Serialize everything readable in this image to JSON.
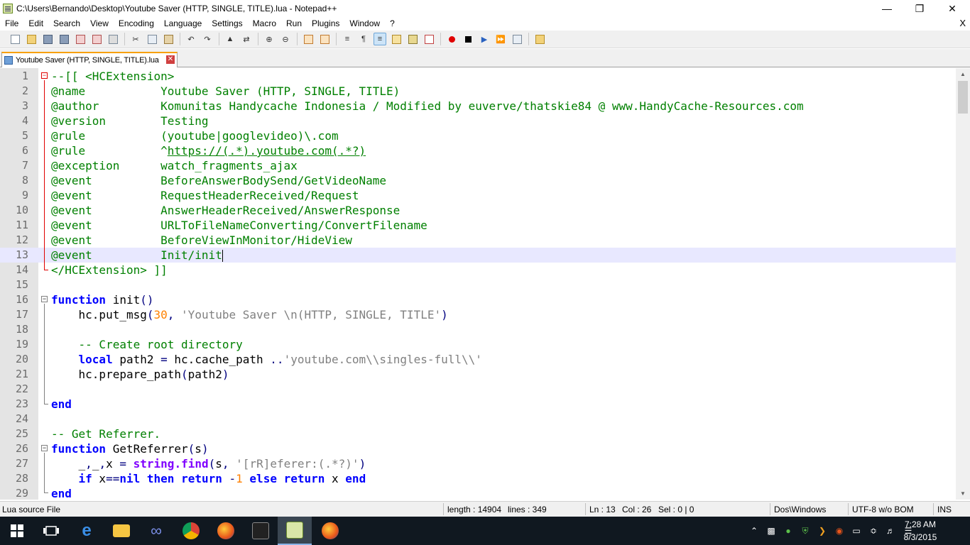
{
  "window": {
    "title": "C:\\Users\\Bernando\\Desktop\\Youtube Saver (HTTP, SINGLE, TITLE).lua - Notepad++",
    "minimize_icon": "minimize-icon",
    "maximize_icon": "restore-icon",
    "close_icon": "close-icon"
  },
  "menu": {
    "items": [
      "File",
      "Edit",
      "Search",
      "View",
      "Encoding",
      "Language",
      "Settings",
      "Macro",
      "Run",
      "Plugins",
      "Window",
      "?"
    ],
    "close_label": "X"
  },
  "toolbar": {
    "buttons": [
      "new-file-icon",
      "open-file-icon",
      "save-icon",
      "save-all-icon",
      "close-file-icon",
      "close-all-icon",
      "print-icon",
      "cut-icon",
      "copy-icon",
      "paste-icon",
      "undo-icon",
      "redo-icon",
      "find-icon",
      "replace-icon",
      "zoom-in-icon",
      "zoom-out-icon",
      "sync-vertical-icon",
      "sync-horizontal-icon",
      "word-wrap-icon",
      "show-all-chars-icon",
      "indent-guide-icon",
      "user-language-icon",
      "doc-map-icon",
      "function-list-icon",
      "record-macro-icon",
      "stop-record-icon",
      "playback-macro-icon",
      "run-macro-multiple-icon",
      "save-macro-icon",
      "plugin-icon"
    ]
  },
  "tab": {
    "label": "Youtube Saver (HTTP, SINGLE, TITLE).lua",
    "close_icon": "tab-close-icon"
  },
  "editor": {
    "current_line": 13,
    "lines": [
      {
        "n": "1",
        "t": "--[[ <HCExtension>"
      },
      {
        "n": "2",
        "t": "@name           Youtube Saver (HTTP, SINGLE, TITLE)"
      },
      {
        "n": "3",
        "t": "@author         Komunitas Handycache Indonesia / Modified by euverve/thatskie84 @ www.HandyCache-Resources.com"
      },
      {
        "n": "4",
        "t": "@version        Testing"
      },
      {
        "n": "5",
        "t": "@rule           (youtube|googlevideo)\\.com"
      },
      {
        "n": "6",
        "t": "@rule           ^https://(.*).youtube.com(.*?)"
      },
      {
        "n": "7",
        "t": "@exception      watch_fragments_ajax"
      },
      {
        "n": "8",
        "t": "@event          BeforeAnswerBodySend/GetVideoName"
      },
      {
        "n": "9",
        "t": "@event          RequestHeaderReceived/Request"
      },
      {
        "n": "10",
        "t": "@event          AnswerHeaderReceived/AnswerResponse"
      },
      {
        "n": "11",
        "t": "@event          URLToFileNameConverting/ConvertFilename"
      },
      {
        "n": "12",
        "t": "@event          BeforeViewInMonitor/HideView"
      },
      {
        "n": "13",
        "t": "@event          Init/init"
      },
      {
        "n": "14",
        "t": "</HCExtension> ]]"
      },
      {
        "n": "15",
        "t": ""
      },
      {
        "n": "16",
        "t": "function init()"
      },
      {
        "n": "17",
        "t": "    hc.put_msg(30, 'Youtube Saver \\n(HTTP, SINGLE, TITLE')"
      },
      {
        "n": "18",
        "t": ""
      },
      {
        "n": "19",
        "t": "    -- Create root directory"
      },
      {
        "n": "20",
        "t": "    local path2 = hc.cache_path ..'youtube.com\\\\singles-full\\\\'"
      },
      {
        "n": "21",
        "t": "    hc.prepare_path(path2)"
      },
      {
        "n": "22",
        "t": ""
      },
      {
        "n": "23",
        "t": "end"
      },
      {
        "n": "24",
        "t": ""
      },
      {
        "n": "25",
        "t": "-- Get Referrer."
      },
      {
        "n": "26",
        "t": "function GetReferrer(s)"
      },
      {
        "n": "27",
        "t": "    _,_,x = string.find(s, '[rR]eferer:(.*?)')"
      },
      {
        "n": "28",
        "t": "    if x==nil then return -1 else return x end"
      },
      {
        "n": "29",
        "t": "end"
      }
    ]
  },
  "status": {
    "file_type": "Lua source File",
    "length": "length : 14904",
    "lines": "lines : 349",
    "ln": "Ln : 13",
    "col": "Col : 26",
    "sel": "Sel : 0 | 0",
    "eol": "Dos\\Windows",
    "encoding": "UTF-8 w/o BOM",
    "mode": "INS"
  },
  "taskbar": {
    "apps": [
      "windows-start-icon",
      "task-view-icon",
      "edge-icon",
      "file-explorer-icon",
      "infinity-app-icon",
      "chrome-icon",
      "firefox-icon",
      "instant-demo-icon",
      "notepadpp-icon",
      "firefox-alt-icon"
    ],
    "tray_icons": [
      "chevron-up-icon",
      "network-share-icon",
      "green-app-icon",
      "shield-icon",
      "handycache-icon",
      "firefox-tray-icon",
      "battery-icon",
      "wifi-icon",
      "volume-icon"
    ],
    "time": "7:28 AM",
    "date": "8/3/2015",
    "notifications_icon": "notifications-icon"
  }
}
